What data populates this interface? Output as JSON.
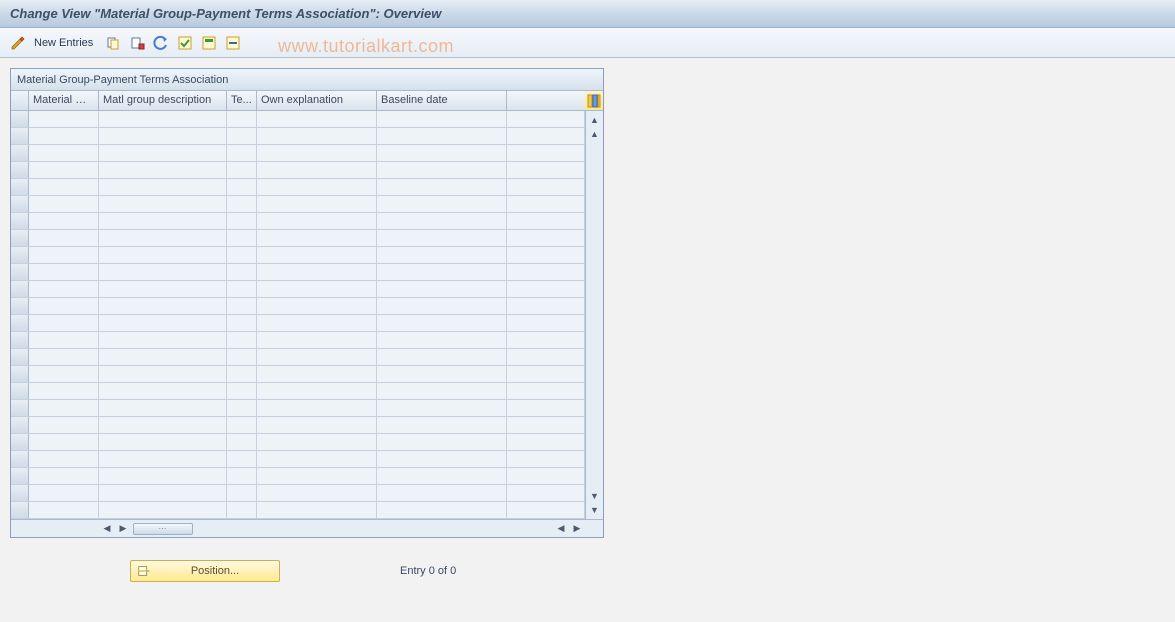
{
  "title": "Change View \"Material Group-Payment Terms Association\": Overview",
  "toolbar": {
    "new_entries_label": "New Entries"
  },
  "panel": {
    "title": "Material Group-Payment Terms Association"
  },
  "table": {
    "columns": {
      "material_group": "Material Gr...",
      "matl_group_desc": "Matl group description",
      "terms": "Te...",
      "own_explanation": "Own explanation",
      "baseline_date": "Baseline date"
    },
    "rows": []
  },
  "footer": {
    "position_label": "Position...",
    "entry_label": "Entry 0 of 0"
  },
  "watermark": "www.tutorialkart.com"
}
